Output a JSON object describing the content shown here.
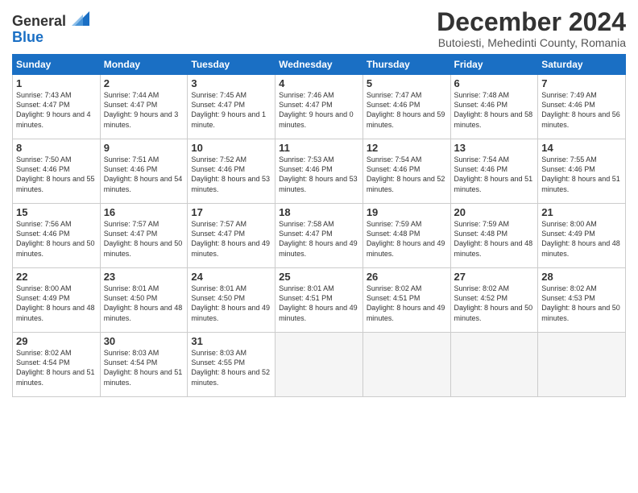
{
  "header": {
    "logo_general": "General",
    "logo_blue": "Blue",
    "month_title": "December 2024",
    "subtitle": "Butoiesti, Mehedinti County, Romania"
  },
  "days_of_week": [
    "Sunday",
    "Monday",
    "Tuesday",
    "Wednesday",
    "Thursday",
    "Friday",
    "Saturday"
  ],
  "weeks": [
    [
      {
        "num": "1",
        "sunrise": "7:43 AM",
        "sunset": "4:47 PM",
        "daylight": "9 hours and 4 minutes."
      },
      {
        "num": "2",
        "sunrise": "7:44 AM",
        "sunset": "4:47 PM",
        "daylight": "9 hours and 3 minutes."
      },
      {
        "num": "3",
        "sunrise": "7:45 AM",
        "sunset": "4:47 PM",
        "daylight": "9 hours and 1 minute."
      },
      {
        "num": "4",
        "sunrise": "7:46 AM",
        "sunset": "4:47 PM",
        "daylight": "9 hours and 0 minutes."
      },
      {
        "num": "5",
        "sunrise": "7:47 AM",
        "sunset": "4:46 PM",
        "daylight": "8 hours and 59 minutes."
      },
      {
        "num": "6",
        "sunrise": "7:48 AM",
        "sunset": "4:46 PM",
        "daylight": "8 hours and 58 minutes."
      },
      {
        "num": "7",
        "sunrise": "7:49 AM",
        "sunset": "4:46 PM",
        "daylight": "8 hours and 56 minutes."
      }
    ],
    [
      {
        "num": "8",
        "sunrise": "7:50 AM",
        "sunset": "4:46 PM",
        "daylight": "8 hours and 55 minutes."
      },
      {
        "num": "9",
        "sunrise": "7:51 AM",
        "sunset": "4:46 PM",
        "daylight": "8 hours and 54 minutes."
      },
      {
        "num": "10",
        "sunrise": "7:52 AM",
        "sunset": "4:46 PM",
        "daylight": "8 hours and 53 minutes."
      },
      {
        "num": "11",
        "sunrise": "7:53 AM",
        "sunset": "4:46 PM",
        "daylight": "8 hours and 53 minutes."
      },
      {
        "num": "12",
        "sunrise": "7:54 AM",
        "sunset": "4:46 PM",
        "daylight": "8 hours and 52 minutes."
      },
      {
        "num": "13",
        "sunrise": "7:54 AM",
        "sunset": "4:46 PM",
        "daylight": "8 hours and 51 minutes."
      },
      {
        "num": "14",
        "sunrise": "7:55 AM",
        "sunset": "4:46 PM",
        "daylight": "8 hours and 51 minutes."
      }
    ],
    [
      {
        "num": "15",
        "sunrise": "7:56 AM",
        "sunset": "4:46 PM",
        "daylight": "8 hours and 50 minutes."
      },
      {
        "num": "16",
        "sunrise": "7:57 AM",
        "sunset": "4:47 PM",
        "daylight": "8 hours and 50 minutes."
      },
      {
        "num": "17",
        "sunrise": "7:57 AM",
        "sunset": "4:47 PM",
        "daylight": "8 hours and 49 minutes."
      },
      {
        "num": "18",
        "sunrise": "7:58 AM",
        "sunset": "4:47 PM",
        "daylight": "8 hours and 49 minutes."
      },
      {
        "num": "19",
        "sunrise": "7:59 AM",
        "sunset": "4:48 PM",
        "daylight": "8 hours and 49 minutes."
      },
      {
        "num": "20",
        "sunrise": "7:59 AM",
        "sunset": "4:48 PM",
        "daylight": "8 hours and 48 minutes."
      },
      {
        "num": "21",
        "sunrise": "8:00 AM",
        "sunset": "4:49 PM",
        "daylight": "8 hours and 48 minutes."
      }
    ],
    [
      {
        "num": "22",
        "sunrise": "8:00 AM",
        "sunset": "4:49 PM",
        "daylight": "8 hours and 48 minutes."
      },
      {
        "num": "23",
        "sunrise": "8:01 AM",
        "sunset": "4:50 PM",
        "daylight": "8 hours and 48 minutes."
      },
      {
        "num": "24",
        "sunrise": "8:01 AM",
        "sunset": "4:50 PM",
        "daylight": "8 hours and 49 minutes."
      },
      {
        "num": "25",
        "sunrise": "8:01 AM",
        "sunset": "4:51 PM",
        "daylight": "8 hours and 49 minutes."
      },
      {
        "num": "26",
        "sunrise": "8:02 AM",
        "sunset": "4:51 PM",
        "daylight": "8 hours and 49 minutes."
      },
      {
        "num": "27",
        "sunrise": "8:02 AM",
        "sunset": "4:52 PM",
        "daylight": "8 hours and 50 minutes."
      },
      {
        "num": "28",
        "sunrise": "8:02 AM",
        "sunset": "4:53 PM",
        "daylight": "8 hours and 50 minutes."
      }
    ],
    [
      {
        "num": "29",
        "sunrise": "8:02 AM",
        "sunset": "4:54 PM",
        "daylight": "8 hours and 51 minutes."
      },
      {
        "num": "30",
        "sunrise": "8:03 AM",
        "sunset": "4:54 PM",
        "daylight": "8 hours and 51 minutes."
      },
      {
        "num": "31",
        "sunrise": "8:03 AM",
        "sunset": "4:55 PM",
        "daylight": "8 hours and 52 minutes."
      },
      null,
      null,
      null,
      null
    ]
  ]
}
